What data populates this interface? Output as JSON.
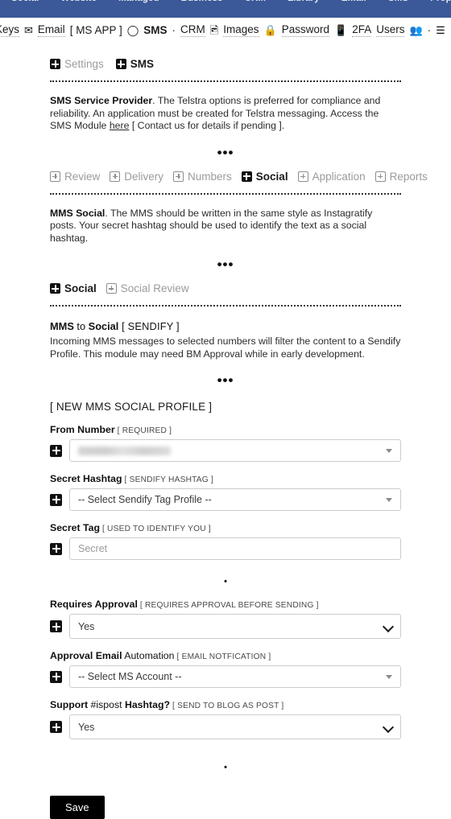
{
  "navbar": {
    "items": [
      {
        "label": "Social"
      },
      {
        "label": "Website"
      },
      {
        "label": "Managed"
      },
      {
        "label": "Business"
      },
      {
        "label": "CRM"
      },
      {
        "label": "Library"
      },
      {
        "label": "Email"
      },
      {
        "label": "SMS"
      },
      {
        "label": "Property"
      }
    ],
    "gear_icon": "gear-icon",
    "background": "#3b5998"
  },
  "toolbar": {
    "items": [
      {
        "type": "text",
        "label": "Keys",
        "bold": false,
        "underline": true
      },
      {
        "type": "icon",
        "icon": "envelope-icon",
        "glyph": "✉"
      },
      {
        "type": "text",
        "label": "Email",
        "bold": false,
        "underline": true
      },
      {
        "type": "text",
        "label": "[ MS APP ]",
        "bold": false,
        "underline": false
      },
      {
        "type": "icon",
        "icon": "chat-bubble-icon",
        "glyph": "◯"
      },
      {
        "type": "text",
        "label": "SMS",
        "bold": true,
        "underline": false
      },
      {
        "type": "text",
        "label": "·",
        "bold": false,
        "underline": false
      },
      {
        "type": "text",
        "label": "CRM",
        "bold": false,
        "underline": true
      },
      {
        "type": "icon",
        "icon": "image-icon",
        "glyph": "Ὓc"
      },
      {
        "type": "text",
        "label": "Images",
        "bold": false,
        "underline": true
      },
      {
        "type": "icon",
        "icon": "lock-icon",
        "glyph": "ὑ2"
      },
      {
        "type": "text",
        "label": "Password",
        "bold": false,
        "underline": true
      },
      {
        "type": "icon",
        "icon": "mobile-phone-icon",
        "glyph": "὏1"
      },
      {
        "type": "text",
        "label": "2FA",
        "bold": false,
        "underline": true
      },
      {
        "type": "text",
        "label": "Users",
        "bold": false,
        "underline": true
      },
      {
        "type": "icon",
        "icon": "users-group-icon",
        "glyph": "὆5"
      },
      {
        "type": "text",
        "label": "·",
        "bold": false,
        "underline": false
      },
      {
        "type": "icon",
        "icon": "hamburger-menu-icon",
        "glyph": "☰"
      }
    ]
  },
  "breadcrumb": {
    "items": [
      {
        "label": "Settings",
        "active": false,
        "icon": "plus-square-filled-icon"
      },
      {
        "label": "SMS",
        "active": true,
        "icon": "plus-square-filled-icon"
      }
    ]
  },
  "intro": {
    "lead": "SMS Service Provider",
    "body_1": ". The Telstra options is preferred for compliance and reliability. An application must be created for Telstra messaging. Access the SMS Module ",
    "link": "here",
    "body_2": " [ Contact us for details if pending ]."
  },
  "ellipsis": {
    "triple": "•••",
    "single": "•"
  },
  "tabs_primary": {
    "items": [
      {
        "label": "Review",
        "active": false
      },
      {
        "label": "Delivery",
        "active": false
      },
      {
        "label": "Numbers",
        "active": false
      },
      {
        "label": "Social",
        "active": true
      },
      {
        "label": "Application",
        "active": false
      },
      {
        "label": "Reports",
        "active": false
      }
    ]
  },
  "mms_social": {
    "lead": "MMS Social",
    "body": ". The MMS should be written in the same style as Instagratify posts. Your secret hashtag should be used to identify the text as a social hashtag."
  },
  "tabs_secondary": {
    "items": [
      {
        "label": "Social",
        "active": true
      },
      {
        "label": "Social Review",
        "active": false
      }
    ]
  },
  "mms_to_social": {
    "title_a": "MMS",
    "title_b": " to ",
    "title_c": "Social",
    "title_tag": " [ SENDIFY ]",
    "body": "Incoming MMS messages to selected numbers will filter the content to a Sendify Profile. This module may need BM Approval while in early development."
  },
  "profile_heading": "[ NEW MMS SOCIAL PROFILE ]",
  "form": {
    "fields": [
      {
        "name": "from-number",
        "label_bold": "From Number",
        "label_norm": "",
        "hint": "[ REQUIRED ]",
        "control": "select-soft",
        "value": "",
        "redacted": true,
        "placeholder": ""
      },
      {
        "name": "secret-hashtag",
        "label_bold": "Secret Hashtag",
        "label_norm": "",
        "hint": "[ SENDIFY HASHTAG ]",
        "control": "select-soft",
        "value": "-- Select Sendify Tag Profile --",
        "redacted": false,
        "placeholder": ""
      },
      {
        "name": "secret-tag",
        "label_bold": "Secret Tag",
        "label_norm": "",
        "hint": "[ USED TO IDENTIFY YOU ]",
        "control": "text",
        "value": "",
        "redacted": false,
        "placeholder": "Secret"
      }
    ],
    "fields_2": [
      {
        "name": "requires-approval",
        "label_bold": "Requires Approval",
        "label_norm": "",
        "hint": "[ REQUIRES APPROVAL BEFORE SENDING ]",
        "control": "select-hard",
        "value": "Yes",
        "redacted": false,
        "placeholder": ""
      },
      {
        "name": "approval-email-automation",
        "label_bold": "Approval Email",
        "label_norm": " Automation",
        "hint": "[ EMAIL NOTFICATION ]",
        "control": "select-soft",
        "value": "-- Select MS Account --",
        "redacted": false,
        "placeholder": ""
      },
      {
        "name": "support-ispost-hashtag",
        "label_bold": "Support",
        "label_norm": " #ispost",
        "label_bold2": " Hashtag?",
        "hint": "[ SEND TO BLOG AS POST ]",
        "control": "select-hard",
        "value": "Yes",
        "redacted": false,
        "placeholder": ""
      }
    ],
    "save_label": "Save"
  }
}
